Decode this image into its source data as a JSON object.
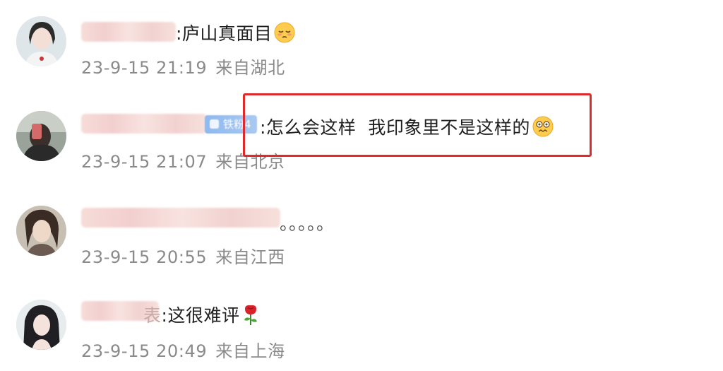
{
  "comments": [
    {
      "text": ":庐山真面目",
      "emoji": "sleepy-face-emoji",
      "date": "23-9-15 21:19",
      "location": "来自湖北"
    },
    {
      "badge": "铁粉4",
      "text": ":怎么会这样  我印象里不是这样的",
      "emoji": "astonished-face-emoji",
      "date": "23-9-15 21:07",
      "location": "来自北京",
      "highlighted": true
    },
    {
      "text": "。。。。。",
      "date": "23-9-15 20:55",
      "location": "来自江西"
    },
    {
      "text_suffix": "表",
      "text": ":这很难评",
      "emoji": "rose-emoji",
      "date": "23-9-15 20:49",
      "location": "来自上海"
    }
  ],
  "colors": {
    "highlight_border": "#e02a2a",
    "meta_text": "#8a8a8a",
    "body_text": "#1f1f1f"
  }
}
